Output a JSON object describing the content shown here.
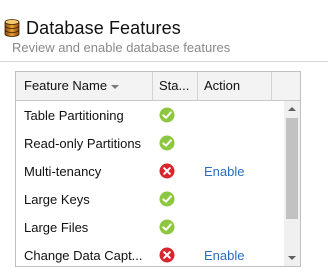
{
  "header": {
    "title": "Database Features",
    "subtitle": "Review and enable database features",
    "icon": "database-icon"
  },
  "table": {
    "columns": {
      "name": "Feature Name",
      "status": "Sta...",
      "action": "Action"
    },
    "rows": [
      {
        "name": "Table Partitioning",
        "status": "enabled",
        "status_icon": "check-circle-icon",
        "action": ""
      },
      {
        "name": "Read-only Partitions",
        "status": "enabled",
        "status_icon": "check-circle-icon",
        "action": ""
      },
      {
        "name": "Multi-tenancy",
        "status": "disabled",
        "status_icon": "error-circle-icon",
        "action": "Enable"
      },
      {
        "name": "Large Keys",
        "status": "enabled",
        "status_icon": "check-circle-icon",
        "action": ""
      },
      {
        "name": "Large Files",
        "status": "enabled",
        "status_icon": "check-circle-icon",
        "action": ""
      },
      {
        "name": "Change Data Capt...",
        "status": "disabled",
        "status_icon": "error-circle-icon",
        "action": "Enable"
      }
    ]
  },
  "colors": {
    "enabled": "#8dc63f",
    "disabled": "#d9262e",
    "link": "#2a6ebd"
  }
}
